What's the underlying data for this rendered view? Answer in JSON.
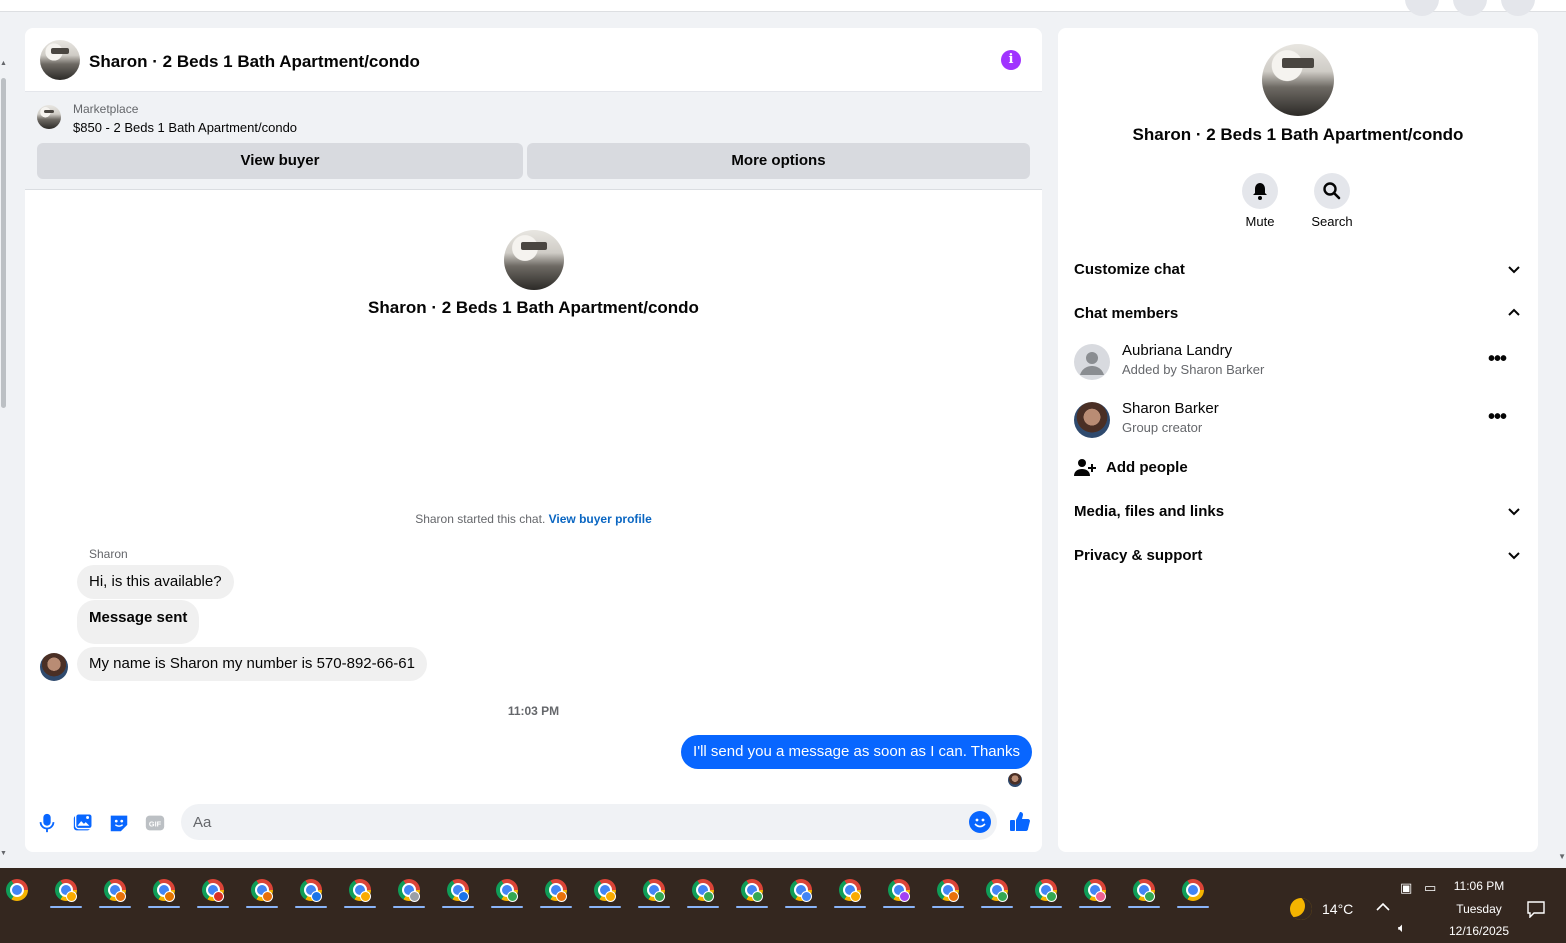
{
  "chat": {
    "title": "Sharon · 2 Beds 1 Bath Apartment/condo",
    "marketplace_label": "Marketplace",
    "listing": "$850 - 2 Beds 1 Bath Apartment/condo",
    "view_buyer": "View buyer",
    "more_options": "More options",
    "center_title": "Sharon · 2 Beds 1 Bath Apartment/condo",
    "started_text": "Sharon started this chat.",
    "view_buyer_profile": "View buyer profile",
    "sender_name": "Sharon",
    "messages_received": [
      "Hi, is this available?",
      "Message sent",
      "My name is Sharon my number is 570-892-66-61"
    ],
    "timestamp": "11:03 PM",
    "my_message": "I'll send you a message as soon as I can. Thanks",
    "input_placeholder": "Aa",
    "icons": [
      "microphone-icon",
      "photo-icon",
      "sticker-icon",
      "gif-icon",
      "emoji-icon",
      "thumbs-up-icon",
      "info-icon"
    ],
    "accent_color": "#0866ff"
  },
  "info_panel": {
    "title": "Sharon · 2 Beds 1 Bath Apartment/condo",
    "mute_label": "Mute",
    "search_label": "Search",
    "customize_chat": "Customize chat",
    "chat_members": "Chat members",
    "members": [
      {
        "name": "Aubriana Landry",
        "sub": "Added by Sharon Barker"
      },
      {
        "name": "Sharon Barker",
        "sub": "Group creator"
      }
    ],
    "add_people": "Add people",
    "media_files_links": "Media, files and links",
    "privacy_support": "Privacy & support"
  },
  "taskbar": {
    "app_count": 25,
    "profile_colors": [
      "#f9ab00",
      "#e8710a",
      "#e37400",
      "#d93025",
      "#e8710a",
      "#1a73e8",
      "#f9ab00",
      "#9aa0a6",
      "#1a73e8",
      "#34a853",
      "#e8710a",
      "#f9ab00",
      "#34a853",
      "#34a853",
      "#34a853",
      "#4285f4",
      "#f9ab00",
      "#a142f4",
      "#e8710a",
      "#34a853",
      "#34a853",
      "#f06292",
      "#34a853"
    ],
    "temperature": "14°C",
    "time": "11:06 PM",
    "day": "Tuesday",
    "date": "12/16/2025"
  }
}
